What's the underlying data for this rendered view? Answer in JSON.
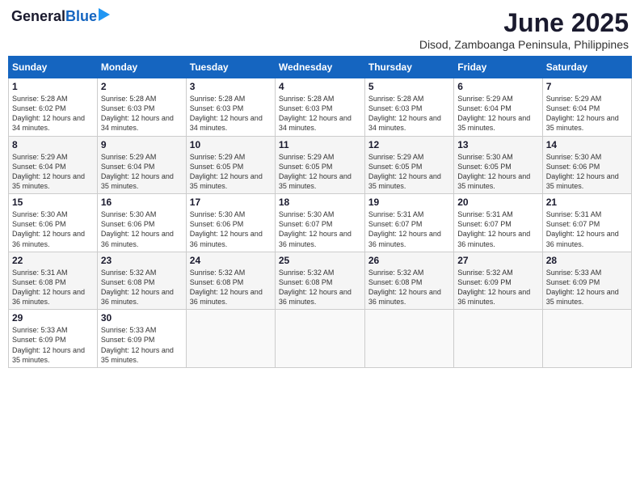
{
  "header": {
    "logo_general": "General",
    "logo_blue": "Blue",
    "title": "June 2025",
    "subtitle": "Disod, Zamboanga Peninsula, Philippines"
  },
  "calendar": {
    "days_of_week": [
      "Sunday",
      "Monday",
      "Tuesday",
      "Wednesday",
      "Thursday",
      "Friday",
      "Saturday"
    ],
    "weeks": [
      [
        null,
        {
          "day": 2,
          "sunrise": "5:28 AM",
          "sunset": "6:03 PM",
          "daylight": "12 hours and 34 minutes."
        },
        {
          "day": 3,
          "sunrise": "5:28 AM",
          "sunset": "6:03 PM",
          "daylight": "12 hours and 34 minutes."
        },
        {
          "day": 4,
          "sunrise": "5:28 AM",
          "sunset": "6:03 PM",
          "daylight": "12 hours and 34 minutes."
        },
        {
          "day": 5,
          "sunrise": "5:28 AM",
          "sunset": "6:03 PM",
          "daylight": "12 hours and 34 minutes."
        },
        {
          "day": 6,
          "sunrise": "5:29 AM",
          "sunset": "6:04 PM",
          "daylight": "12 hours and 35 minutes."
        },
        {
          "day": 7,
          "sunrise": "5:29 AM",
          "sunset": "6:04 PM",
          "daylight": "12 hours and 35 minutes."
        }
      ],
      [
        {
          "day": 8,
          "sunrise": "5:29 AM",
          "sunset": "6:04 PM",
          "daylight": "12 hours and 35 minutes."
        },
        {
          "day": 9,
          "sunrise": "5:29 AM",
          "sunset": "6:04 PM",
          "daylight": "12 hours and 35 minutes."
        },
        {
          "day": 10,
          "sunrise": "5:29 AM",
          "sunset": "6:05 PM",
          "daylight": "12 hours and 35 minutes."
        },
        {
          "day": 11,
          "sunrise": "5:29 AM",
          "sunset": "6:05 PM",
          "daylight": "12 hours and 35 minutes."
        },
        {
          "day": 12,
          "sunrise": "5:29 AM",
          "sunset": "6:05 PM",
          "daylight": "12 hours and 35 minutes."
        },
        {
          "day": 13,
          "sunrise": "5:30 AM",
          "sunset": "6:05 PM",
          "daylight": "12 hours and 35 minutes."
        },
        {
          "day": 14,
          "sunrise": "5:30 AM",
          "sunset": "6:06 PM",
          "daylight": "12 hours and 35 minutes."
        }
      ],
      [
        {
          "day": 15,
          "sunrise": "5:30 AM",
          "sunset": "6:06 PM",
          "daylight": "12 hours and 36 minutes."
        },
        {
          "day": 16,
          "sunrise": "5:30 AM",
          "sunset": "6:06 PM",
          "daylight": "12 hours and 36 minutes."
        },
        {
          "day": 17,
          "sunrise": "5:30 AM",
          "sunset": "6:06 PM",
          "daylight": "12 hours and 36 minutes."
        },
        {
          "day": 18,
          "sunrise": "5:30 AM",
          "sunset": "6:07 PM",
          "daylight": "12 hours and 36 minutes."
        },
        {
          "day": 19,
          "sunrise": "5:31 AM",
          "sunset": "6:07 PM",
          "daylight": "12 hours and 36 minutes."
        },
        {
          "day": 20,
          "sunrise": "5:31 AM",
          "sunset": "6:07 PM",
          "daylight": "12 hours and 36 minutes."
        },
        {
          "day": 21,
          "sunrise": "5:31 AM",
          "sunset": "6:07 PM",
          "daylight": "12 hours and 36 minutes."
        }
      ],
      [
        {
          "day": 22,
          "sunrise": "5:31 AM",
          "sunset": "6:08 PM",
          "daylight": "12 hours and 36 minutes."
        },
        {
          "day": 23,
          "sunrise": "5:32 AM",
          "sunset": "6:08 PM",
          "daylight": "12 hours and 36 minutes."
        },
        {
          "day": 24,
          "sunrise": "5:32 AM",
          "sunset": "6:08 PM",
          "daylight": "12 hours and 36 minutes."
        },
        {
          "day": 25,
          "sunrise": "5:32 AM",
          "sunset": "6:08 PM",
          "daylight": "12 hours and 36 minutes."
        },
        {
          "day": 26,
          "sunrise": "5:32 AM",
          "sunset": "6:08 PM",
          "daylight": "12 hours and 36 minutes."
        },
        {
          "day": 27,
          "sunrise": "5:32 AM",
          "sunset": "6:09 PM",
          "daylight": "12 hours and 36 minutes."
        },
        {
          "day": 28,
          "sunrise": "5:33 AM",
          "sunset": "6:09 PM",
          "daylight": "12 hours and 35 minutes."
        }
      ],
      [
        {
          "day": 29,
          "sunrise": "5:33 AM",
          "sunset": "6:09 PM",
          "daylight": "12 hours and 35 minutes."
        },
        {
          "day": 30,
          "sunrise": "5:33 AM",
          "sunset": "6:09 PM",
          "daylight": "12 hours and 35 minutes."
        },
        null,
        null,
        null,
        null,
        null
      ]
    ],
    "week0_day1": {
      "day": 1,
      "sunrise": "5:28 AM",
      "sunset": "6:02 PM",
      "daylight": "12 hours and 34 minutes."
    }
  }
}
